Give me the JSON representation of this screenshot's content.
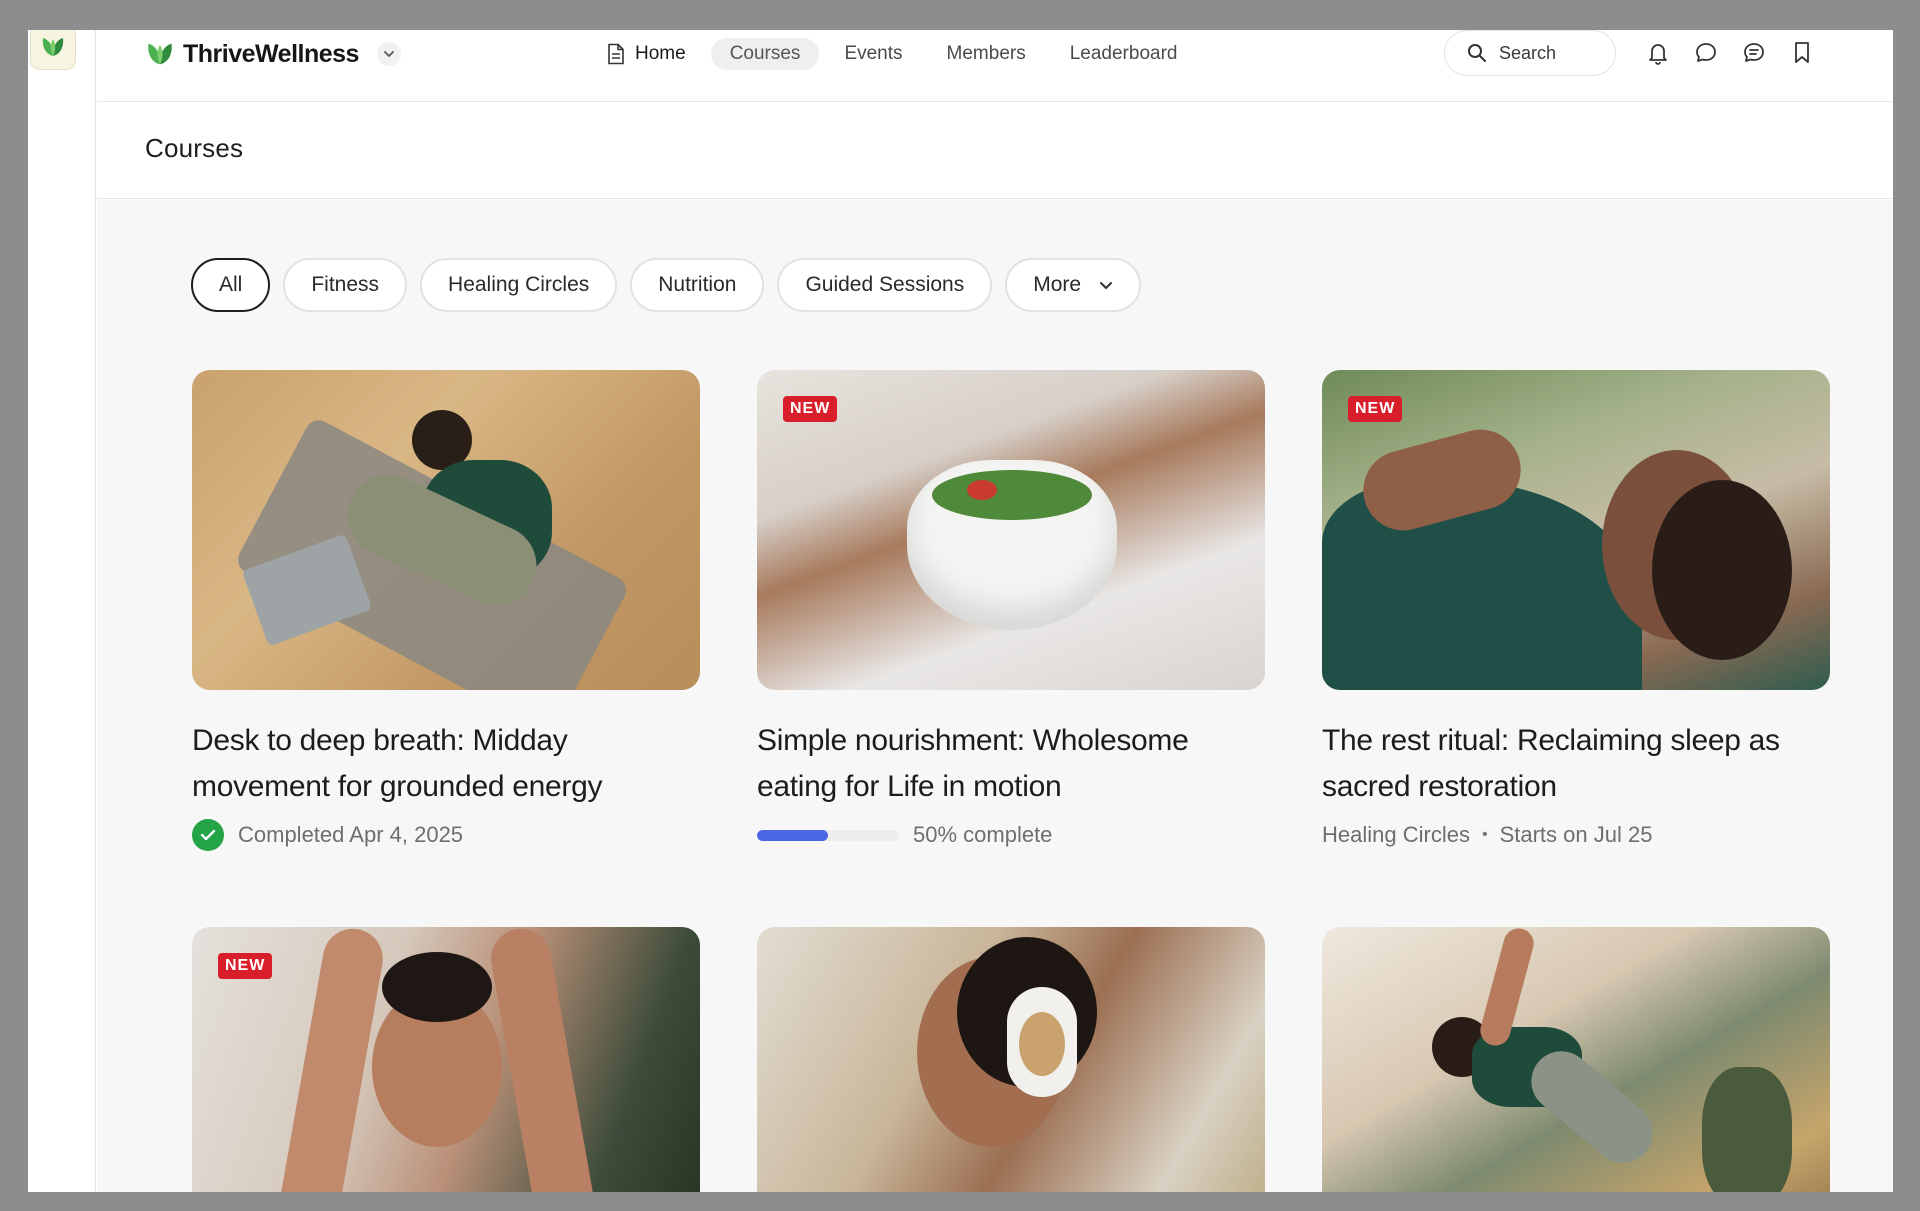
{
  "brand": {
    "name": "ThriveWellness"
  },
  "nav": {
    "items": [
      {
        "label": "Home"
      },
      {
        "label": "Courses"
      },
      {
        "label": "Events"
      },
      {
        "label": "Members"
      },
      {
        "label": "Leaderboard"
      }
    ],
    "active": "Courses"
  },
  "search": {
    "label": "Search"
  },
  "header_icons": [
    "bell-icon",
    "chat-bubble-icon",
    "messages-icon",
    "bookmark-icon"
  ],
  "page": {
    "title": "Courses"
  },
  "filters": [
    {
      "label": "All",
      "active": true
    },
    {
      "label": "Fitness"
    },
    {
      "label": "Healing Circles"
    },
    {
      "label": "Nutrition"
    },
    {
      "label": "Guided Sessions"
    },
    {
      "label": "More"
    }
  ],
  "courses": [
    {
      "title": "Desk to deep breath: Midday movement for grounded energy",
      "badge": "",
      "status": "Completed Apr 4, 2025"
    },
    {
      "title": "Simple nourishment: Wholesome eating for Life in motion",
      "badge": "NEW",
      "progress": 0.5,
      "progress_label": "50% complete"
    },
    {
      "title": "The rest ritual: Reclaiming sleep as sacred restoration",
      "badge": "NEW",
      "category": "Healing Circles",
      "schedule": "Starts on Jul 25"
    },
    {
      "title": "",
      "badge": "NEW"
    },
    {
      "title": "",
      "badge": ""
    },
    {
      "title": "",
      "badge": ""
    }
  ],
  "colors": {
    "brand_green": "#4caf50",
    "new_badge": "#d81e2a",
    "progress": "#4a66e4",
    "completed": "#22a447"
  }
}
